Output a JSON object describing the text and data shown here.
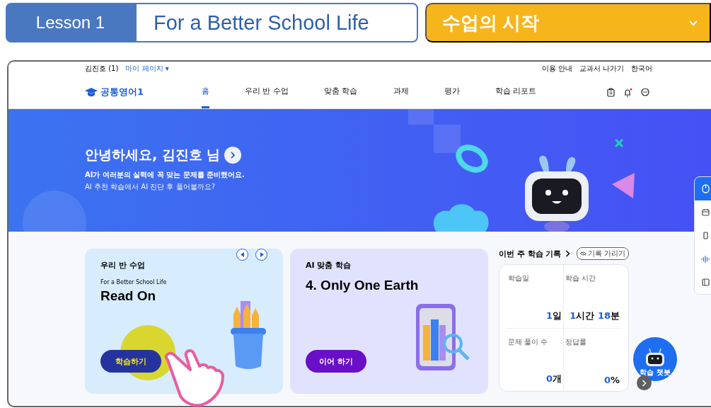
{
  "lesson_header": {
    "lesson": "Lesson 1",
    "title": "For a Better School Life",
    "stage": "수업의 시작"
  },
  "utility_bar": {
    "user": "김진호 (1)",
    "my_page": "마이 페이지 ▾",
    "links": [
      "이용 안내",
      "교과서 나가기",
      "한국어"
    ]
  },
  "nav": {
    "logo": "공통영어1",
    "items": [
      {
        "label": "홈",
        "selected": true
      },
      {
        "label": "우리 반 수업",
        "selected": false
      },
      {
        "label": "맞춤 학습",
        "selected": false
      },
      {
        "label": "과제",
        "selected": false
      },
      {
        "label": "평가",
        "selected": false
      },
      {
        "label": "학습 리포트",
        "selected": false
      }
    ],
    "notification": true
  },
  "hero": {
    "greeting": "안녕하세요, 김진호 님",
    "line_1": "AI가 여러분의 실력에 꼭 맞는 문제를 준비했어요.",
    "line_2": "AI 추천 학습에서 AI 진단 후 풀어볼까요?"
  },
  "cards": [
    {
      "kind": "class",
      "heading": "우리 반 수업",
      "subtitle": "For a Better School Life",
      "title": "Read On",
      "button": "학습하기"
    },
    {
      "kind": "ai",
      "heading": "AI 맞춤 학습",
      "title": "4. Only One Earth",
      "button": "이어 하기"
    }
  ],
  "weekly_record": {
    "title": "이번 주 학습 기록",
    "hide_button": "기록 가리기",
    "stats": [
      {
        "label": "학습일",
        "parts": [
          {
            "text": "1",
            "kind": "number"
          },
          {
            "text": "일",
            "kind": "unit"
          }
        ]
      },
      {
        "label": "학습 시간",
        "parts": [
          {
            "text": "1",
            "kind": "number"
          },
          {
            "text": "시간 ",
            "kind": "unit"
          },
          {
            "text": "18",
            "kind": "number"
          },
          {
            "text": "분",
            "kind": "unit"
          }
        ]
      },
      {
        "label": "문제 풀이 수",
        "parts": [
          {
            "text": "0",
            "kind": "number"
          },
          {
            "text": "개",
            "kind": "unit"
          }
        ]
      },
      {
        "label": "정답률",
        "parts": [
          {
            "text": "0",
            "kind": "number"
          },
          {
            "text": "%",
            "kind": "unit"
          }
        ]
      }
    ]
  },
  "side_toolbar": [
    {
      "kind": "timer",
      "selected": true
    },
    {
      "kind": "calendar",
      "selected": false
    },
    {
      "kind": "device",
      "selected": false
    },
    {
      "kind": "voice",
      "selected": false
    },
    {
      "kind": "book",
      "selected": false
    }
  ],
  "chatbot": {
    "label": "학습 챗봇"
  }
}
